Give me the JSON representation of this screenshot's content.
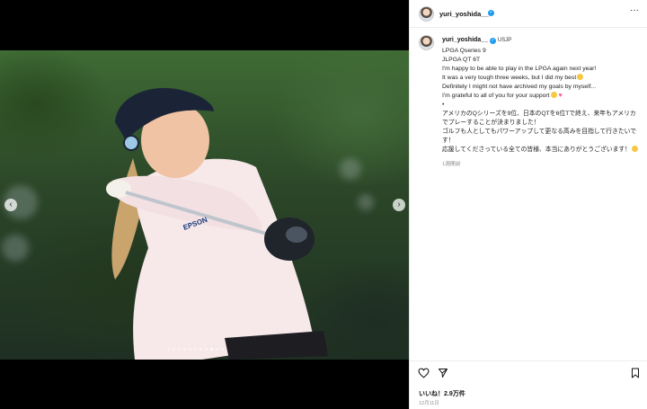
{
  "post": {
    "username": "yuri_yoshida__",
    "location": "USJP",
    "caption_lines": [
      "LPGA Qseries 9",
      "JLPGA QT 6T",
      "I'm happy to be able to play in the LPGA again next year!",
      "It was a very tough three weeks, but I did my best",
      "Definitely I might not have archived my goals by myself...",
      "I'm grateful to all of you for your support",
      "•",
      "アメリカのQシリーズを9位、日本のQTを6位Tで終え、来年もアメリカでプレーすることが決まりました！",
      "ゴルフも人としてもパワーアップして更なる高みを目指して行きたいです！",
      "応援してくださっている全ての皆様、本当にありがとうございます！"
    ],
    "time_ago": "1週間前",
    "likes": "いいね！2.9万件",
    "date": "12月11日"
  },
  "icons": {
    "more": "more-options-icon",
    "like": "heart-icon",
    "share": "send-icon",
    "save": "bookmark-icon",
    "prev": "chevron-left-icon",
    "next": "chevron-right-icon",
    "verified": "verified-badge-icon"
  },
  "colors": {
    "verified_blue": "#1d9bf0",
    "heart_pink": "#ff4f86",
    "meta_gray": "#8e8e8e"
  },
  "carousel": {
    "slide_count": 11,
    "active_index": 8
  }
}
